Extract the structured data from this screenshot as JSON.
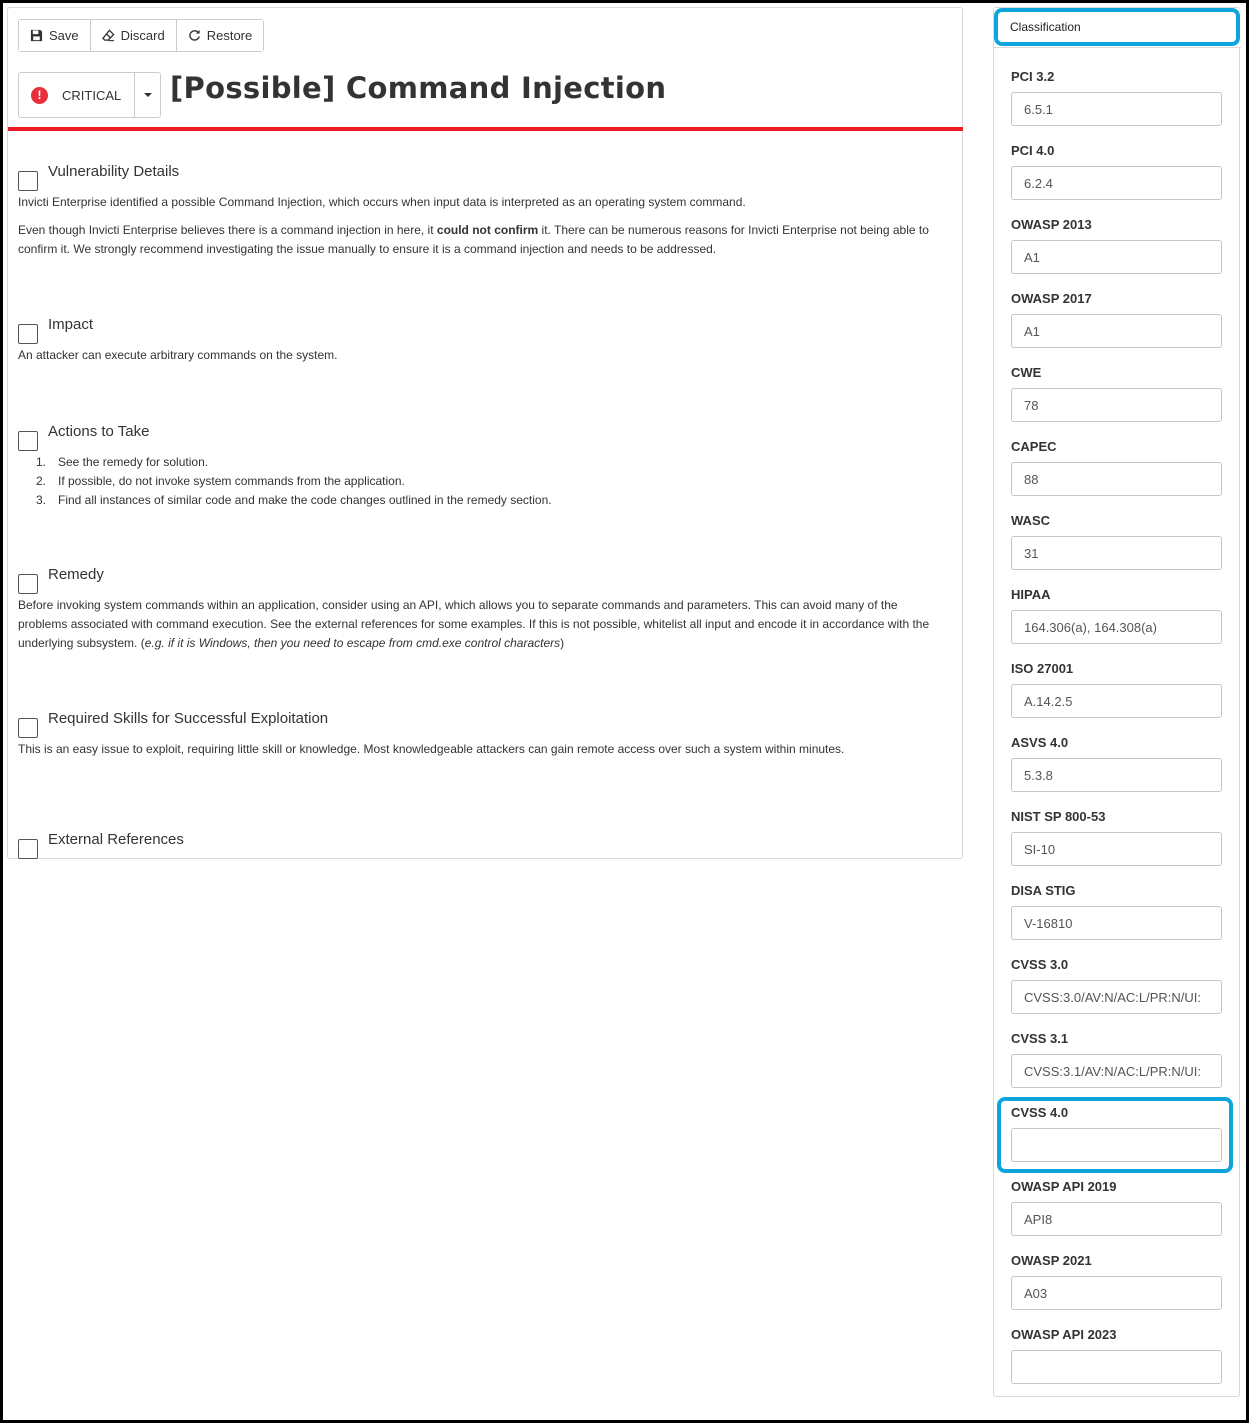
{
  "toolbar": {
    "save_label": "Save",
    "discard_label": "Discard",
    "restore_label": "Restore"
  },
  "severity": {
    "label": "CRITICAL",
    "color": "#e8303a",
    "icon": "exclamation-circle-icon"
  },
  "title": "[Possible] Command Injection",
  "sections": {
    "vuln": {
      "title": "Vulnerability Details",
      "p1": "Invicti Enterprise identified a possible Command Injection, which occurs when input data is interpreted as an operating system command.",
      "p2_before": "Even though Invicti Enterprise believes there is a command injection in here, it ",
      "p2_bold": "could not confirm",
      "p2_after": " it. There can be numerous reasons for Invicti Enterprise not being able to confirm it. We strongly recommend investigating the issue manually to ensure it is a command injection and needs to be addressed."
    },
    "impact": {
      "title": "Impact",
      "text": "An attacker can execute arbitrary commands on the system."
    },
    "actions": {
      "title": "Actions to Take",
      "steps": [
        {
          "num": "1.",
          "text": "See the remedy for solution."
        },
        {
          "num": "2.",
          "text": "If possible, do not invoke system commands from the application."
        },
        {
          "num": "3.",
          "text": "Find all instances of similar code and make the code changes outlined in the remedy section."
        }
      ]
    },
    "remedy": {
      "title": "Remedy",
      "text": "Before invoking system commands within an application, consider using an API, which allows you to separate commands and parameters. This can avoid many of the problems associated with command execution. See the external references for some examples. If this is not possible, whitelist all input and encode it in accordance with the underlying subsystem. (",
      "italic": "e.g. if it is Windows, then you need to escape from cmd.exe control characters",
      "close": ")"
    },
    "skills": {
      "title": "Required Skills for Successful Exploitation",
      "text": "This is an easy issue to exploit, requiring little skill or knowledge. Most knowledgeable attackers can gain remote access over such a system within minutes."
    },
    "refs": {
      "title": "External References"
    }
  },
  "classification": {
    "header": "Classification",
    "fields": [
      {
        "label": "PCI 3.2",
        "value": "6.5.1"
      },
      {
        "label": "PCI 4.0",
        "value": "6.2.4"
      },
      {
        "label": "OWASP 2013",
        "value": "A1"
      },
      {
        "label": "OWASP 2017",
        "value": "A1"
      },
      {
        "label": "CWE",
        "value": "78"
      },
      {
        "label": "CAPEC",
        "value": "88"
      },
      {
        "label": "WASC",
        "value": "31"
      },
      {
        "label": "HIPAA",
        "value": "164.306(a), 164.308(a)"
      },
      {
        "label": "ISO 27001",
        "value": "A.14.2.5"
      },
      {
        "label": "ASVS 4.0",
        "value": "5.3.8"
      },
      {
        "label": "NIST SP 800-53",
        "value": "SI-10"
      },
      {
        "label": "DISA STIG",
        "value": "V-16810"
      },
      {
        "label": "CVSS 3.0",
        "value": "CVSS:3.0/AV:N/AC:L/PR:N/UI:"
      },
      {
        "label": "CVSS 3.1",
        "value": "CVSS:3.1/AV:N/AC:L/PR:N/UI:"
      },
      {
        "label": "CVSS 4.0",
        "value": ""
      },
      {
        "label": "OWASP API 2019",
        "value": "API8"
      },
      {
        "label": "OWASP 2021",
        "value": "A03"
      },
      {
        "label": "OWASP API 2023",
        "value": ""
      }
    ]
  },
  "colors": {
    "accent_red": "#ee1c24",
    "highlight_blue": "#0ea5dd"
  }
}
